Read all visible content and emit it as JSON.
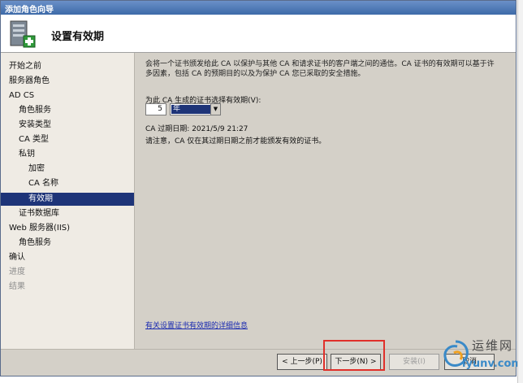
{
  "window": {
    "title": "添加角色向导"
  },
  "header": {
    "title": "设置有效期",
    "icon": "server-wizard-icon"
  },
  "sidebar": {
    "items": [
      {
        "label": "开始之前",
        "state": "normal"
      },
      {
        "label": "服务器角色",
        "state": "normal"
      },
      {
        "label": "AD CS",
        "state": "normal"
      },
      {
        "label": "角色服务",
        "state": "normal"
      },
      {
        "label": "安装类型",
        "state": "normal"
      },
      {
        "label": "CA 类型",
        "state": "normal"
      },
      {
        "label": "私钥",
        "state": "normal"
      },
      {
        "label": "加密",
        "state": "normal"
      },
      {
        "label": "CA 名称",
        "state": "normal"
      },
      {
        "label": "有效期",
        "state": "active"
      },
      {
        "label": "证书数据库",
        "state": "normal"
      },
      {
        "label": "Web 服务器(IIS)",
        "state": "normal"
      },
      {
        "label": "角色服务",
        "state": "normal"
      },
      {
        "label": "确认",
        "state": "normal"
      },
      {
        "label": "进度",
        "state": "disabled"
      },
      {
        "label": "结果",
        "state": "disabled"
      }
    ]
  },
  "main": {
    "intro": "会将一个证书颁发给此 CA 以保护与其他 CA 和请求证书的客户端之间的通信。CA 证书的有效期可以基于许多因素，包括 CA 的预期目的以及为保护 CA 您已采取的安全措施。",
    "period_label": "为此 CA 生成的证书选择有效期(V):",
    "period_value": "5",
    "period_unit": "年",
    "expiry": "CA 过期日期:  2021/5/9 21:27",
    "note": "请注意，CA 仅在其过期日期之前才能颁发有效的证书。",
    "help_link": "有关设置证书有效期的详细信息"
  },
  "footer": {
    "back": "< 上一步(P)",
    "next": "下一步(N) >",
    "install": "安装(I)",
    "cancel": "取消"
  },
  "watermark": {
    "cn": "运维网",
    "en": "iyunv.com"
  },
  "colors": {
    "accent": "#1e3478",
    "highlight": "#e0302a",
    "link": "#1a2ab0"
  }
}
